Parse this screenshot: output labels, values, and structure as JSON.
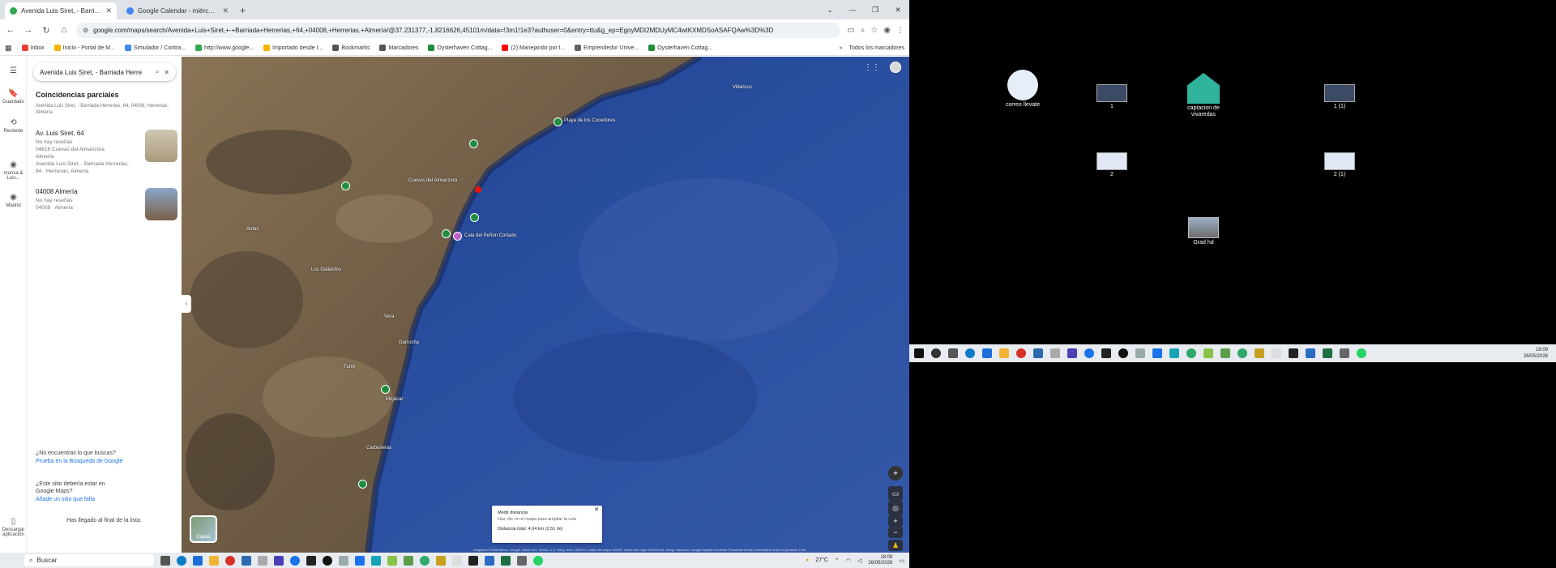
{
  "browser": {
    "tabs": [
      {
        "title": "Avenida Luis Siret, - Barriada H",
        "active": true,
        "favicon_color": "#34a853"
      },
      {
        "title": "Google Calendar - miércoles, 2",
        "active": false,
        "favicon_color": "#4285f4"
      }
    ],
    "window_controls": [
      "⌄",
      "—",
      "❐",
      "✕"
    ],
    "url": "google.com/maps/search/Avenida+Luis+Siret,+-+Barriada+Herrerias,+64,+04008,+Herrerias,+Almería/@37.231377,-1.8216626,45101m/data=!3m1!1e3?authuser=0&entry=ttu&g_ep=EgoyMDI2MDUyMC4wIKXMDSoASAFQAw%3D%3D",
    "bookmarks": [
      "Inbox",
      "Inicio - Portal de M...",
      "Simulador / Contra...",
      "http://www.google...",
      "Importado desde I...",
      "Bookmarks",
      "Marcadores",
      "Oysterhaven Cottag...",
      "(2) Manejando por l...",
      "Emprendedor Unive...",
      "Oysterhaven Cottag..."
    ],
    "bookmark_colors": [
      "#ea4335",
      "#f4b400",
      "#4285f4",
      "#34a853",
      "#f4b400",
      "#555555",
      "#555555",
      "#1e8e3e",
      "#ff0000",
      "#5f6368",
      "#1e8e3e"
    ],
    "all_bookmarks": "Todos los marcadores"
  },
  "rail": {
    "items": [
      {
        "icon": "☰",
        "label": ""
      },
      {
        "icon": "🔖",
        "label": "Guardado"
      },
      {
        "icon": "⟲",
        "label": "Reciente"
      },
      {
        "icon": "◉",
        "label": "murcia & Luis..."
      },
      {
        "icon": "◉",
        "label": "Madrid"
      },
      {
        "icon": "▯",
        "label": "Descargar aplicación"
      }
    ]
  },
  "panel": {
    "search_query": "Avenida Luis Siret, - Barriada Herre",
    "title": "Coincidencias parciales",
    "subtitle": "Avenida Luis Siret, - Barriada Herrerias, 64, 04008, Herrerias, Almería",
    "results": [
      {
        "name": "Av. Luis Siret, 64",
        "lines": [
          "No hay reseñas",
          "04618 Cuevas del Almanzora",
          "Almería",
          "Avenida Luis Siret, - Barriada Herrerias,",
          "64 · Herrerias, Almería"
        ]
      },
      {
        "name": "04008 Almería",
        "lines": [
          "No hay reseñas",
          "04008 · Almería"
        ]
      }
    ],
    "not_found_q": "¿No encuentras lo que buscas?",
    "not_found_link": "Prueba en la Búsqueda de Google",
    "missing_q": "¿Este sitio debería estar en Google Maps?",
    "missing_link": "Añade un sitio que falta",
    "end_text": "Has llegado al final de la lista."
  },
  "map": {
    "labels": [
      "Playa de los Cocedores",
      "Cala del Peñón Cortado",
      "Villaricos",
      "Vera",
      "Garrucha",
      "Mojácar",
      "Los Gallardos",
      "Turre",
      "Carboneras",
      "Antas",
      "Cuevas del Almanzora"
    ],
    "layers_label": "Capas",
    "measure": {
      "title": "Medir distancia",
      "hint": "Haz clic en el mapa para ampliar la ruta",
      "total": "Distancia total: 4,04 km (2,51 mi)"
    },
    "attribution": "Imágenes ©2026 Airbus, Google, Datos SIO, NOAA, U.S. Navy, NGA, GEBCO, Datos del mapa ©2026 · Datos del mapa ©2026 Inst. Geogr. Nacional, Google   España   Términos   Privacidad   Enviar comentarios sobre el producto   2 km"
  },
  "taskbar_left": {
    "search_placeholder": "Buscar",
    "weather": "27°C",
    "time": "18:09",
    "date": "26/05/2026"
  },
  "desktop": {
    "icons": [
      {
        "label": "correo llevate"
      },
      {
        "label": "1"
      },
      {
        "label": "captacion de vivaredas"
      },
      {
        "label": "1 (1)"
      },
      {
        "label": "2"
      },
      {
        "label": "2 (1)"
      },
      {
        "label": "Grad hd"
      }
    ],
    "time": "18:09",
    "date": "26/05/2026"
  }
}
